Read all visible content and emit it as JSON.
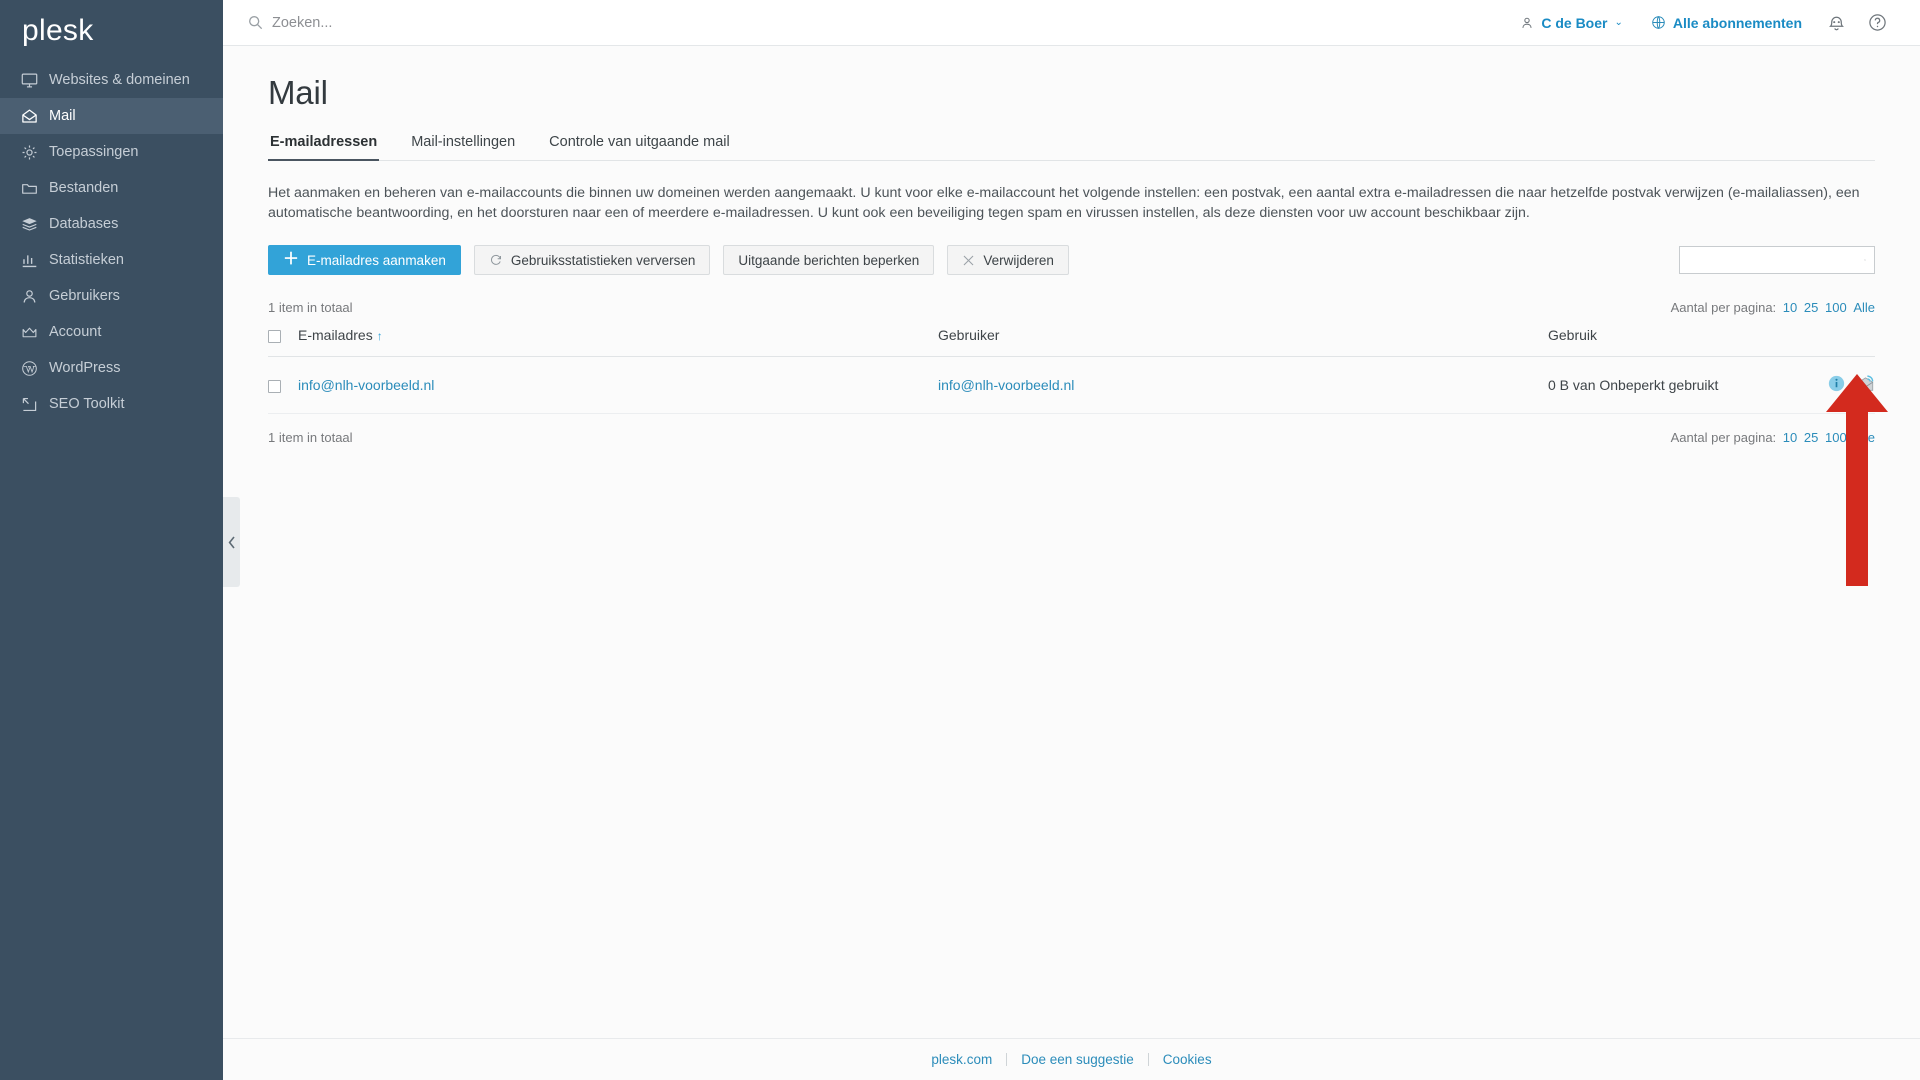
{
  "brand": {
    "name": "plesk"
  },
  "sidebar": {
    "collapse_label": "‹",
    "items": [
      {
        "label": "Websites & domeinen",
        "icon": "monitor-icon"
      },
      {
        "label": "Mail",
        "icon": "mail-icon"
      },
      {
        "label": "Toepassingen",
        "icon": "gear-icon"
      },
      {
        "label": "Bestanden",
        "icon": "folder-icon"
      },
      {
        "label": "Databases",
        "icon": "database-icon"
      },
      {
        "label": "Statistieken",
        "icon": "chart-icon"
      },
      {
        "label": "Gebruikers",
        "icon": "user-icon"
      },
      {
        "label": "Account",
        "icon": "crown-icon"
      },
      {
        "label": "WordPress",
        "icon": "wordpress-icon"
      },
      {
        "label": "SEO Toolkit",
        "icon": "seo-icon"
      }
    ],
    "active_index": 1
  },
  "topbar": {
    "search_placeholder": "Zoeken...",
    "search_value": "",
    "user_label": "C de Boer",
    "chevron": "⌄",
    "subscriptions_label": "Alle abonnementen",
    "notifications_icon": "bell-icon",
    "help_icon": "help-icon"
  },
  "page": {
    "title": "Mail",
    "tabs": [
      {
        "label": "E-mailadressen"
      },
      {
        "label": "Mail-instellingen"
      },
      {
        "label": "Controle van uitgaande mail"
      }
    ],
    "active_tab": 0,
    "description": "Het aanmaken en beheren van e-mailaccounts die binnen uw domeinen werden aangemaakt. U kunt voor elke e-mailaccount het volgende instellen: een postvak, een aantal extra e-mailadressen die naar hetzelfde postvak verwijzen (e-mailaliassen), een automatische beantwoording, en het doorsturen naar een of meerdere e-mailadressen. U kunt ook een beveiliging tegen spam en virussen instellen, als deze diensten voor uw account beschikbaar zijn."
  },
  "toolbar": {
    "create_label": "E-mailadres aanmaken",
    "refresh_stats_label": "Gebruiksstatistieken verversen",
    "limit_outgoing_label": "Uitgaande berichten beperken",
    "delete_label": "Verwijderen",
    "list_search_value": "",
    "list_search_placeholder": ""
  },
  "list": {
    "total_top": "1 item in totaal",
    "total_bottom": "1 item in totaal",
    "per_page_label": "Aantal per pagina:",
    "per_page_options": [
      "10",
      "25",
      "100",
      "Alle"
    ],
    "columns": [
      "E-mailadres",
      "Gebruiker",
      "Gebruik"
    ],
    "sort_indicator": "↑",
    "rows": [
      {
        "email": "info@nlh-voorbeeld.nl",
        "user": "info@nlh-voorbeeld.nl",
        "usage": "0 B van Onbeperkt gebruikt",
        "actions": [
          "info-icon",
          "webmail-icon"
        ]
      }
    ]
  },
  "footer": {
    "links": [
      "plesk.com",
      "Doe een suggestie",
      "Cookies"
    ]
  },
  "annotation": {
    "type": "arrow",
    "color": "#d32a1e",
    "points_to": "webmail-icon"
  },
  "colors": {
    "sidebar_bg": "#3b4f61",
    "sidebar_active": "#4b5f72",
    "accent_blue": "#32a3d8",
    "link_blue": "#2b8cba",
    "content_bg": "#fbfbfb",
    "annotation_red": "#d32a1e"
  }
}
